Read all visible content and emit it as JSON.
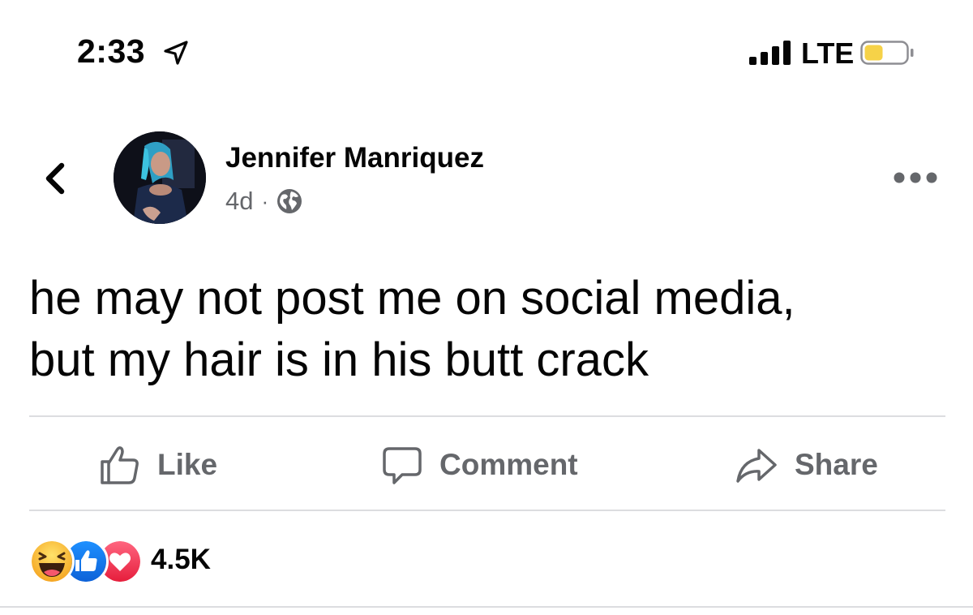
{
  "status_bar": {
    "time": "2:33",
    "network": "LTE",
    "location_icon": "location-arrow-icon",
    "signal_icon": "signal-bars-icon",
    "battery_icon": "battery-icon",
    "battery_level": 0.4,
    "battery_color": "#f6d248"
  },
  "post": {
    "author": "Jennifer Manriquez",
    "timestamp": "4d",
    "separator": "·",
    "audience_icon": "globe-icon",
    "text_lines": [
      "he may not post me on social media,",
      "but my hair is in his butt crack"
    ]
  },
  "actions": {
    "like_label": "Like",
    "comment_label": "Comment",
    "share_label": "Share"
  },
  "reactions": {
    "icons": [
      "haha-icon",
      "like-reaction-icon",
      "love-icon"
    ],
    "count": "4.5K"
  },
  "colors": {
    "text_primary": "#050505",
    "text_secondary": "#65676b",
    "like_blue": "#1b74e4",
    "love_red": "#f33e58",
    "haha_yellow": "#f7b125"
  }
}
